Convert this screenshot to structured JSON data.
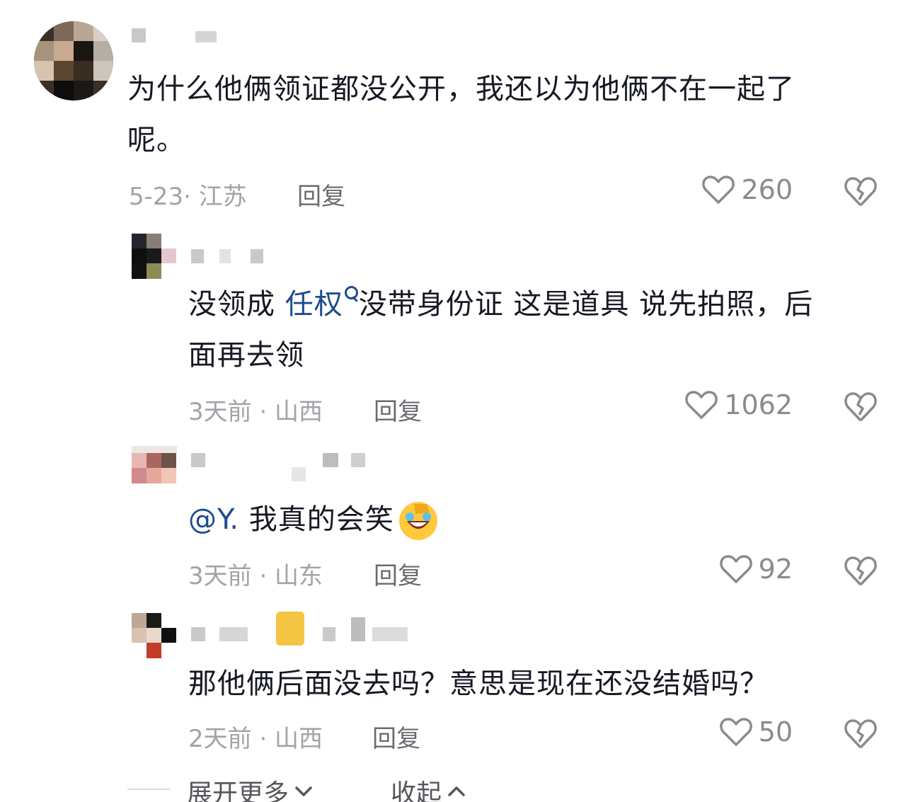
{
  "comments": [
    {
      "text_lines": [
        "为什么他俩领证都没公开，我还以为他俩不在一起了",
        "呢。"
      ],
      "date_location": "5-23· 江苏",
      "reply_label": "回复",
      "likes": "260"
    },
    {
      "text_before": "没领成 ",
      "mention": "任权",
      "text_after": "没带身份证 这是道具 说先拍照，后",
      "text_line2": "面再去领",
      "date_location": "3天前 · 山西",
      "reply_label": "回复",
      "likes": "1062"
    },
    {
      "mention": "@Y.",
      "text_after": " 我真的会笑",
      "emoji": "face-with-hand-laughing",
      "date_location": "3天前 · 山东",
      "reply_label": "回复",
      "likes": "92"
    },
    {
      "text": "那他俩后面没去吗？意思是现在还没结婚吗？",
      "date_location": "2天前 · 山西",
      "reply_label": "回复",
      "likes": "50"
    }
  ],
  "footer": {
    "expand_label": "展开更多",
    "collapse_label": "收起"
  },
  "icons": {
    "like": "heart-outline-icon",
    "dislike": "broken-heart-icon",
    "expand": "chevron-down-icon",
    "collapse": "chevron-up-icon"
  },
  "colors": {
    "mention": "#1c4c8c",
    "meta": "#a2a3a8",
    "text": "#161823"
  }
}
